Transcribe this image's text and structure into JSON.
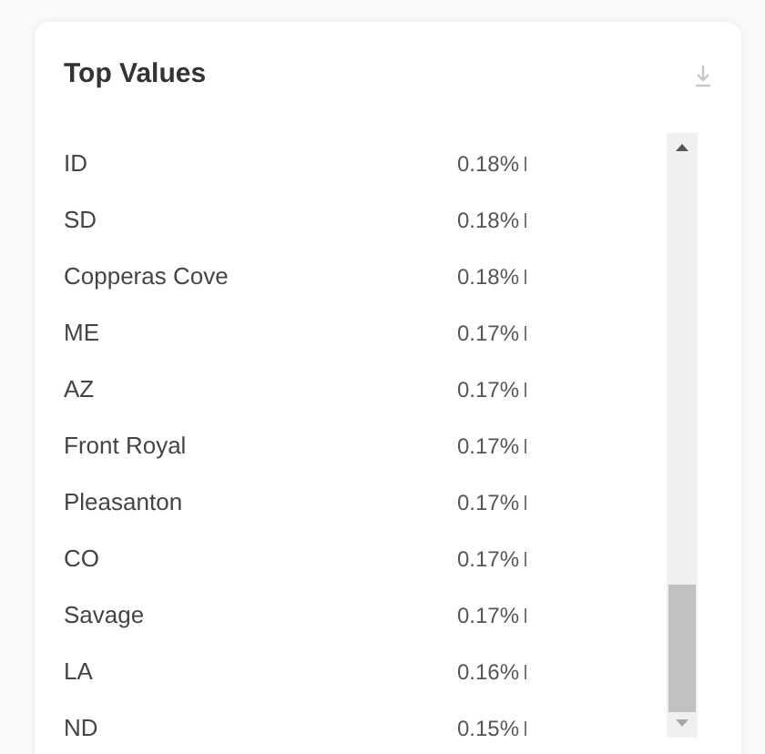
{
  "panel": {
    "title": "Top Values"
  },
  "rows": [
    {
      "label": "ID",
      "value": "0.18%"
    },
    {
      "label": "SD",
      "value": "0.18%"
    },
    {
      "label": "Copperas Cove",
      "value": "0.18%"
    },
    {
      "label": "ME",
      "value": "0.17%"
    },
    {
      "label": "AZ",
      "value": "0.17%"
    },
    {
      "label": "Front Royal",
      "value": "0.17%"
    },
    {
      "label": "Pleasanton",
      "value": "0.17%"
    },
    {
      "label": "CO",
      "value": "0.17%"
    },
    {
      "label": "Savage",
      "value": "0.17%"
    },
    {
      "label": "LA",
      "value": "0.16%"
    },
    {
      "label": "ND",
      "value": "0.15%"
    }
  ]
}
